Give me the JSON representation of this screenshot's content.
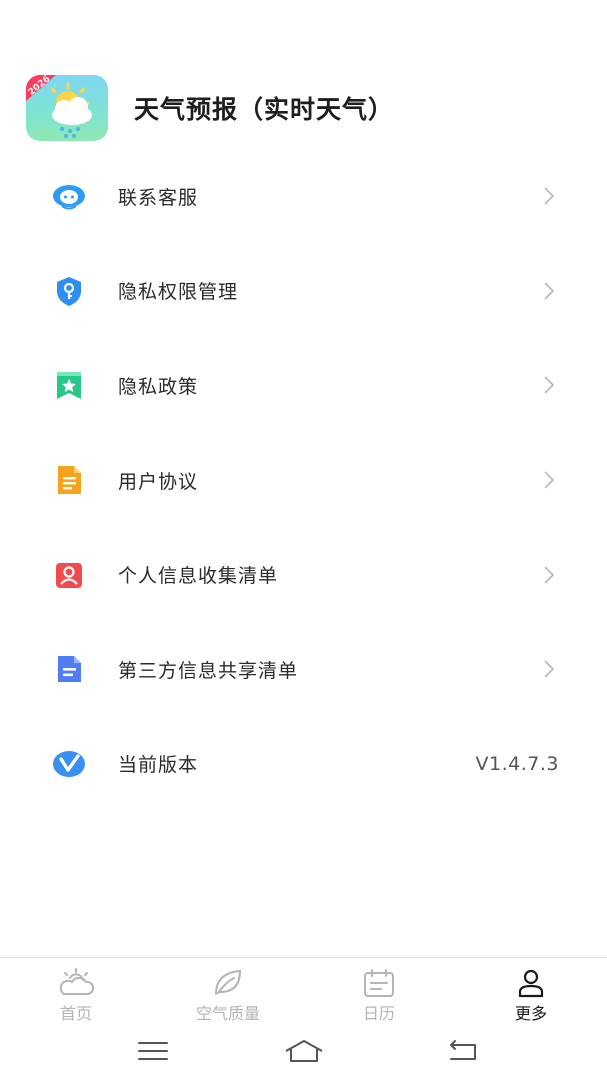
{
  "app": {
    "title": "天气预报（实时天气）",
    "badge": "2026"
  },
  "menu": [
    {
      "label": "联系客服",
      "icon": "customer-service-icon",
      "color": "#2f9bf3"
    },
    {
      "label": "隐私权限管理",
      "icon": "shield-key-icon",
      "color": "#2d8ff0"
    },
    {
      "label": "隐私政策",
      "icon": "bookmark-star-icon",
      "color": "#27c98b"
    },
    {
      "label": "用户协议",
      "icon": "document-icon",
      "color": "#f7a21b"
    },
    {
      "label": "个人信息收集清单",
      "icon": "person-card-icon",
      "color": "#f24b4b"
    },
    {
      "label": "第三方信息共享清单",
      "icon": "file-share-icon",
      "color": "#4f7ef0"
    },
    {
      "label": "当前版本",
      "icon": "version-v-icon",
      "color": "#3a8ff2",
      "value": "V1.4.7.3"
    }
  ],
  "tabs": [
    {
      "label": "首页",
      "icon": "weather-cloud-icon",
      "active": false
    },
    {
      "label": "空气质量",
      "icon": "leaf-icon",
      "active": false
    },
    {
      "label": "日历",
      "icon": "calendar-icon",
      "active": false
    },
    {
      "label": "更多",
      "icon": "person-icon",
      "active": true
    }
  ]
}
